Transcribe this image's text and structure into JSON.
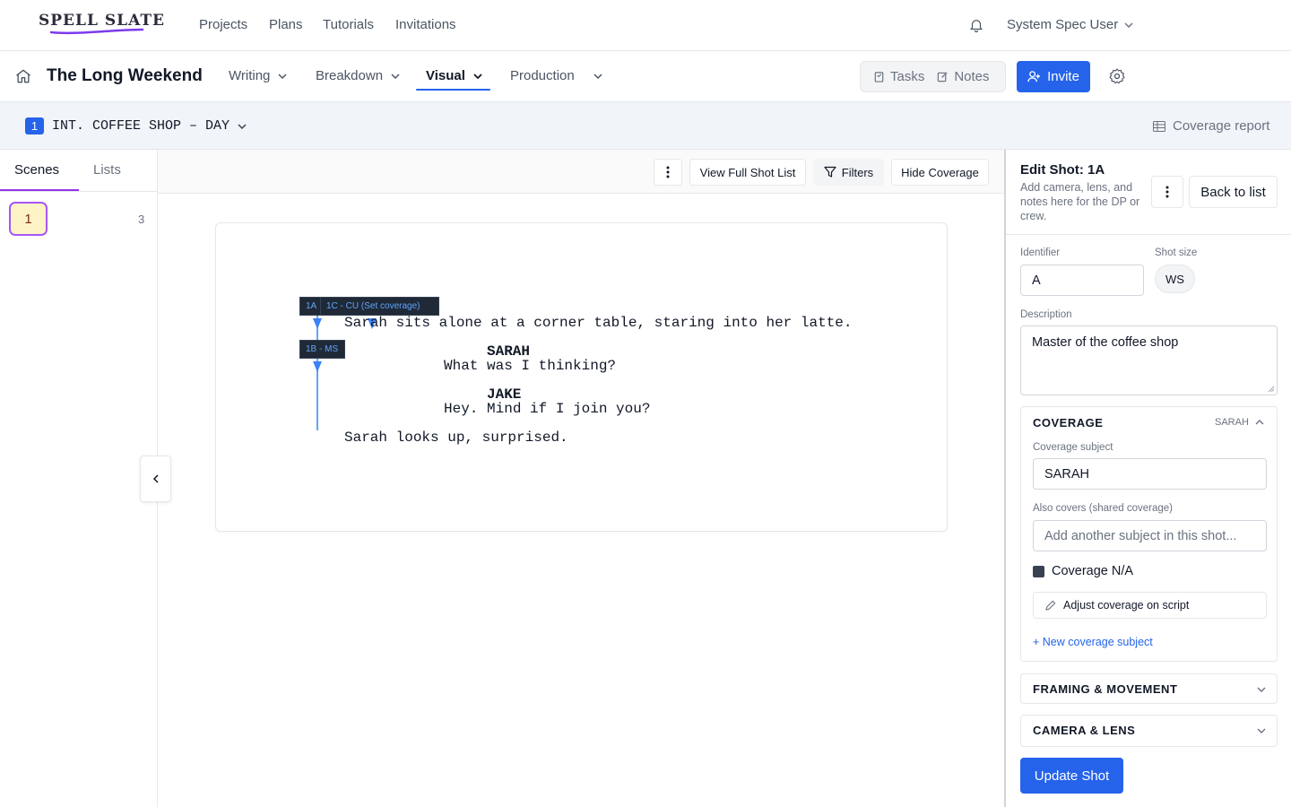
{
  "brand": {
    "logo_text": "SPELL SLATE",
    "accent": "#2563eb"
  },
  "topnav": {
    "links": [
      "Projects",
      "Plans",
      "Tutorials",
      "Invitations"
    ],
    "user": "System Spec User"
  },
  "project": {
    "title": "The Long Weekend",
    "tabs": [
      {
        "label": "Writing"
      },
      {
        "label": "Breakdown"
      },
      {
        "label": "Visual",
        "active": true
      },
      {
        "label": "Production"
      }
    ],
    "tasks_label": "Tasks",
    "notes_label": "Notes",
    "invite_label": "Invite"
  },
  "scene": {
    "number": "1",
    "heading": "INT. COFFEE SHOP – DAY",
    "coverage_report": "Coverage report"
  },
  "sidebar": {
    "tabs": [
      "Scenes",
      "Lists"
    ],
    "scene_chip": "1",
    "scene_count": "3"
  },
  "toolbar": {
    "full_shot_list": "View Full Shot List",
    "filters": "Filters",
    "hide_coverage": "Hide Coverage"
  },
  "script": {
    "lines": [
      "Sarah sits alone at a corner table, staring into her latte.",
      "SARAH",
      "What was I thinking?",
      "JAKE",
      "Hey. Mind if I join you?",
      "Sarah looks up, surprised."
    ],
    "shot_tags": [
      "1A",
      "1C - CU (Set coverage)",
      "1B - MS"
    ]
  },
  "panel": {
    "title": "Edit Shot: 1A",
    "subtitle": "Add camera, lens, and notes here for the DP or crew.",
    "back": "Back to list",
    "identifier_label": "Identifier",
    "identifier_value": "A",
    "shot_size_label": "Shot size",
    "shot_size_value": "WS",
    "description_label": "Description",
    "description_value": "Master of the coffee shop",
    "coverage": {
      "title": "COVERAGE",
      "badge": "SARAH",
      "subject_label": "Coverage subject",
      "subject_value": "SARAH",
      "also_label": "Also covers (shared coverage)",
      "also_placeholder": "Add another subject in this shot...",
      "na_label": "Coverage N/A",
      "adjust_label": "Adjust coverage on script",
      "new_subject": "+ New coverage subject"
    },
    "framing_title": "FRAMING & MOVEMENT",
    "camera_title": "CAMERA & LENS",
    "update": "Update Shot"
  }
}
